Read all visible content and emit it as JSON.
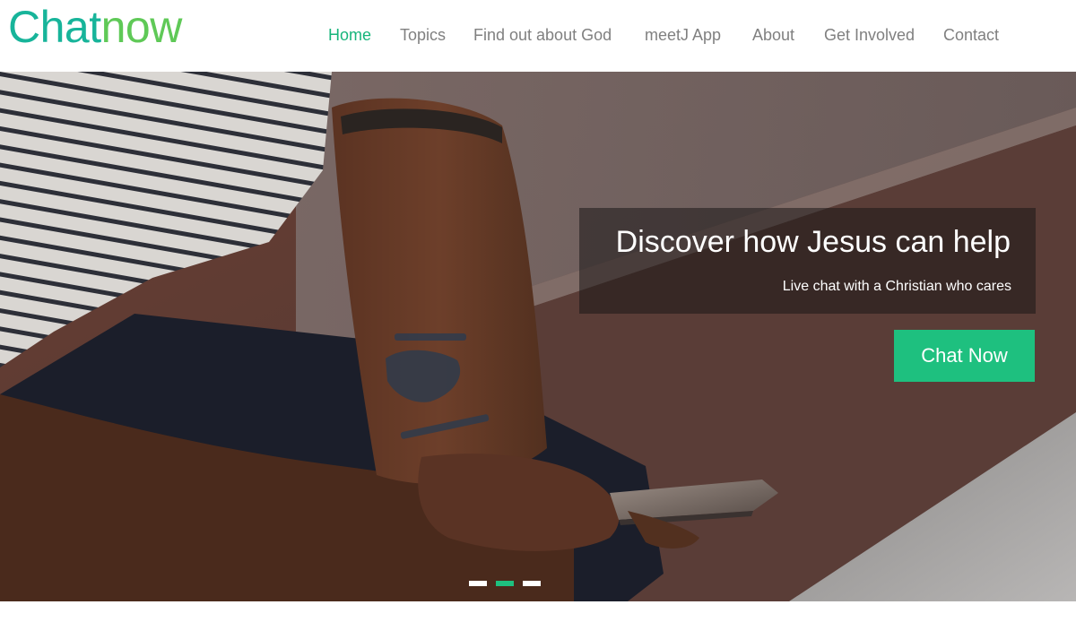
{
  "brand": {
    "logo_part1": "Chat",
    "logo_part2": "now",
    "color_part1": "#17b49a",
    "color_part2": "#5fc957"
  },
  "nav": {
    "items": [
      {
        "label": "Home",
        "active": true
      },
      {
        "label": "Topics",
        "active": false
      },
      {
        "label": "Find out about God",
        "active": false
      },
      {
        "label": "meetJ App",
        "active": false
      },
      {
        "label": "About",
        "active": false
      },
      {
        "label": "Get Involved",
        "active": false
      },
      {
        "label": "Contact",
        "active": false
      }
    ],
    "active_color": "#17b57b",
    "text_color": "#808080"
  },
  "hero": {
    "title": "Discover how Jesus can help",
    "subtitle": "Live chat with a Christian who cares",
    "cta_label": "Chat Now",
    "cta_color": "#1ec07f",
    "slides_total": 3,
    "slide_active": 2
  }
}
